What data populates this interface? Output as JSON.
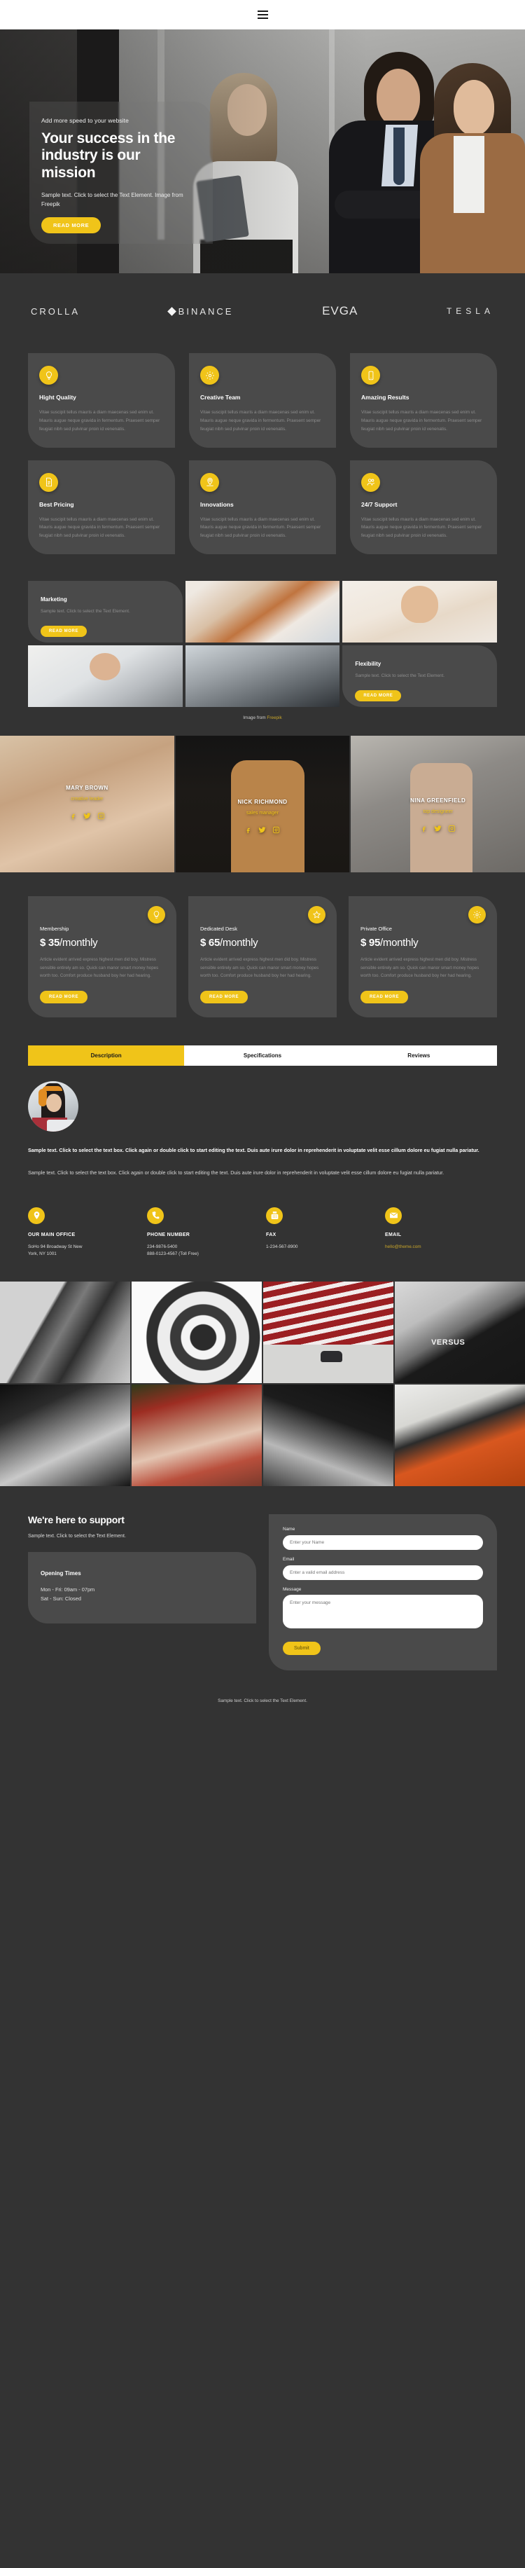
{
  "nav": {
    "menu_icon": "hamburger-menu-icon"
  },
  "hero": {
    "eyebrow": "Add more speed to your website",
    "title": "Your success in the industry is our mission",
    "subtitle": "Sample text. Click to select the Text Element. Image from Freepik",
    "button": "READ MORE"
  },
  "logos": [
    {
      "name": "CROLLA"
    },
    {
      "name": "BINANCE"
    },
    {
      "name": "EVGA"
    },
    {
      "name": "TESLA"
    }
  ],
  "features": {
    "body": "Vitae suscipit tellus mauris a diam maecenas sed enim ut. Mauris augue neque gravida in fermentum. Praesent semper feugiat nibh sed pulvinar proin id venenatis.",
    "items": [
      {
        "title": "Hight Quality",
        "icon": "lightbulb-icon"
      },
      {
        "title": "Creative Team",
        "icon": "gear-icon"
      },
      {
        "title": "Amazing Results",
        "icon": "mobile-phone-icon"
      },
      {
        "title": "Best Pricing",
        "icon": "document-list-icon"
      },
      {
        "title": "Innovations",
        "icon": "map-pin-icon"
      },
      {
        "title": "24/7 Support",
        "icon": "users-icon"
      }
    ]
  },
  "marketing": {
    "card1": {
      "title": "Marketing",
      "text": "Sample text. Click to select the Text Element.",
      "button": "READ MORE"
    },
    "card2": {
      "title": "Flexibility",
      "text": "Sample text. Click to select the Text Element.",
      "button": "READ MORE"
    },
    "credit_prefix": "Image from ",
    "credit_link": "Freepik"
  },
  "team": [
    {
      "name": "MARY BROWN",
      "role": "creative leader"
    },
    {
      "name": "NICK RICHMOND",
      "role": "sales manager"
    },
    {
      "name": "NINA GREENFIELD",
      "role": "top designeer"
    }
  ],
  "pricing": {
    "body": "Article evident arrived express highest men did boy. Mistress sensible entirely am so. Quick can manor smart money hopes worth too. Comfort produce husband boy her had hearing.",
    "button": "READ MORE",
    "plans": [
      {
        "name": "Membership",
        "currency": "$",
        "amount": "35",
        "period": "/monthly",
        "icon": "lightbulb-icon"
      },
      {
        "name": "Dedicated Desk",
        "currency": "$",
        "amount": "65",
        "period": "/monthly",
        "icon": "star-icon"
      },
      {
        "name": "Private Office",
        "currency": "$",
        "amount": "95",
        "period": "/monthly",
        "icon": "gear-icon"
      }
    ]
  },
  "tabs": {
    "items": [
      {
        "label": "Description",
        "active": true
      },
      {
        "label": "Specifications",
        "active": false
      },
      {
        "label": "Reviews",
        "active": false
      }
    ],
    "paragraph_bold": "Sample text. Click to select the text box. Click again or double click to start editing the text. Duis aute irure dolor in reprehenderit in voluptate velit esse cillum dolore eu fugiat nulla pariatur.",
    "paragraph_normal": "Sample text. Click to select the text box. Click again or double click to start editing the text. Duis aute irure dolor in reprehenderit in voluptate velit esse cillum dolore eu fugiat nulla pariatur."
  },
  "contact_info": [
    {
      "title": "OUR MAIN OFFICE",
      "icon": "map-pin-icon",
      "line1": "SoHo 94 Broadway St New",
      "line2": "York, NY 1001"
    },
    {
      "title": "PHONE NUMBER",
      "icon": "phone-icon",
      "line1": "234-9876-5400",
      "line2": "888-0123-4567 (Toll Free)"
    },
    {
      "title": "FAX",
      "icon": "fax-icon",
      "line1": "1-234-567-8900",
      "line2": ""
    },
    {
      "title": "EMAIL",
      "icon": "envelope-icon",
      "line1": "hello@theme.com",
      "line2": ""
    }
  ],
  "support": {
    "title": "We're here to support",
    "subtitle": "Sample text. Click to select the Text Element.",
    "hours_title": "Opening Times",
    "hours_line1": "Mon - Fri: 09am - 07pm",
    "hours_line2": "Sat - Sun: Closed"
  },
  "form": {
    "name_label": "Name",
    "name_placeholder": "Enter your Name",
    "email_label": "Email",
    "email_placeholder": "Enter a valid email address",
    "message_label": "Message",
    "message_placeholder": "Enter your message",
    "submit": "Submit"
  },
  "footer": {
    "text": "Sample text. Click to select the Text Element."
  },
  "colors": {
    "accent": "#f0c419",
    "bg": "#333333",
    "card": "#4a4a4a",
    "link": "#c8a52a"
  }
}
